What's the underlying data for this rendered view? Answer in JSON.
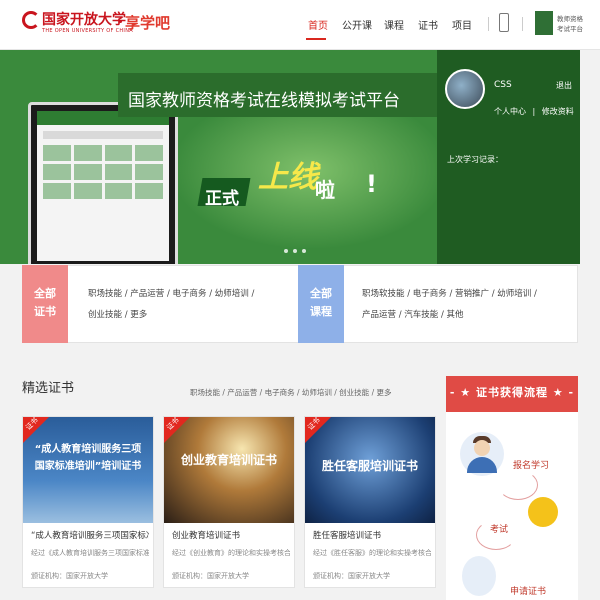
{
  "header": {
    "logo_name": "国家开放大学",
    "logo_sub": "THE OPEN UNIVERSITY OF CHINA",
    "brand": "享学吧",
    "nav": [
      "首页",
      "公开课",
      "课程",
      "证书",
      "项目"
    ],
    "qr_text": [
      "教师资格",
      "考试平台"
    ]
  },
  "banner": {
    "title": "国家教师资格考试在线模拟考试平台",
    "launch_a": "正式",
    "launch_b": "上线",
    "launch_c": "啦",
    "launch_d": "!"
  },
  "user": {
    "name": "CSS",
    "logout": "退出",
    "center": "个人中心",
    "sep": "|",
    "edit": "修改资料",
    "last_study": "上次学习记录："
  },
  "categories": {
    "cert": {
      "badge_line1": "全部",
      "badge_line2": "证书",
      "row1": "职场技能   /   产品运营   /   电子商务   /   幼师培训   /",
      "row2": "创业技能   /   更多"
    },
    "course": {
      "badge_line1": "全部",
      "badge_line2": "课程",
      "row1": "职场软技能   /   电子商务   /   营销推广   /   幼师培训   /",
      "row2": "产品运营   /   汽车技能   /   其他"
    }
  },
  "featured": {
    "title": "精选证书",
    "filters": "职场技能   /   产品运营   /   电子商务   /   幼师培训   /   创业技能   /   更多",
    "cards": [
      {
        "corner": "证书",
        "img_text": "“成人教育培训服务三项国家标准培训”培训证书",
        "title": "“成人教育培训服务三项国家标准...",
        "desc": "经过《成人教育培训服务三项国家标准...",
        "org": "颁证机构：国家开放大学"
      },
      {
        "corner": "证书",
        "img_text": "创业教育培训证书",
        "title": "创业教育培训证书",
        "desc": "经过《创业教育》的理论和实操考核合...",
        "org": "颁证机构：国家开放大学"
      },
      {
        "corner": "证书",
        "img_text": "胜任客服培训证书",
        "title": "胜任客服培训证书",
        "desc": "经过《胜任客服》的理论和实操考核合...",
        "org": "颁证机构：国家开放大学"
      }
    ]
  },
  "process": {
    "title": "- ★ 证书获得流程 ★ -",
    "steps": [
      "报名学习",
      "考试",
      "申请证书"
    ]
  }
}
